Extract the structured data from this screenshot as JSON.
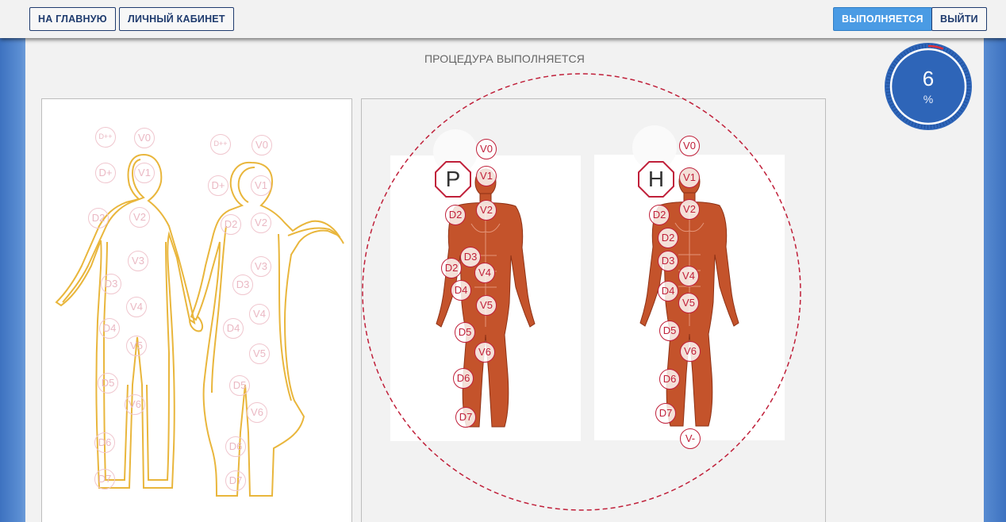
{
  "nav": {
    "home_label": "НА ГЛАВНУЮ",
    "cabinet_label": "ЛИЧНЫЙ КАБИНЕТ",
    "status_label": "ВЫПОЛНЯЕТСЯ",
    "logout_label": "ВЫЙТИ"
  },
  "heading": "ПРОЦЕДУРА ВЫПОЛНЯЕТСЯ",
  "progress": {
    "value": "6",
    "unit": "%",
    "fraction": 0.06
  },
  "colors": {
    "accent": "#c0203a",
    "button_active": "#4a9be4",
    "nav_text": "#1f3b6e",
    "outline": "#e9b63c",
    "muscle": "#c4532b",
    "dial": "#2e65b8"
  },
  "left_panel": {
    "man_points": [
      "D++",
      "V0",
      "D+",
      "V1",
      "D2",
      "V2",
      "V3",
      "D3",
      "V4",
      "D4",
      "V5",
      "D5",
      "V6",
      "D6",
      "D7"
    ],
    "woman_points": [
      "D++",
      "V0",
      "D+",
      "V1",
      "D2",
      "V2",
      "V3",
      "D3",
      "V4",
      "D4",
      "V5",
      "D5",
      "V6",
      "D6",
      "D7"
    ]
  },
  "right_panel": {
    "figure1": {
      "badge": "Р",
      "points": [
        "V0",
        "V1",
        "D2",
        "V2",
        "D3",
        "D2",
        "V4",
        "D4",
        "V5",
        "D5",
        "V6",
        "D6",
        "D7"
      ]
    },
    "figure2": {
      "badge": "Н",
      "points": [
        "V0",
        "V1",
        "D2",
        "V2",
        "D2",
        "D3",
        "V4",
        "D4",
        "V5",
        "D5",
        "V6",
        "D6",
        "D7",
        "V-"
      ]
    }
  }
}
